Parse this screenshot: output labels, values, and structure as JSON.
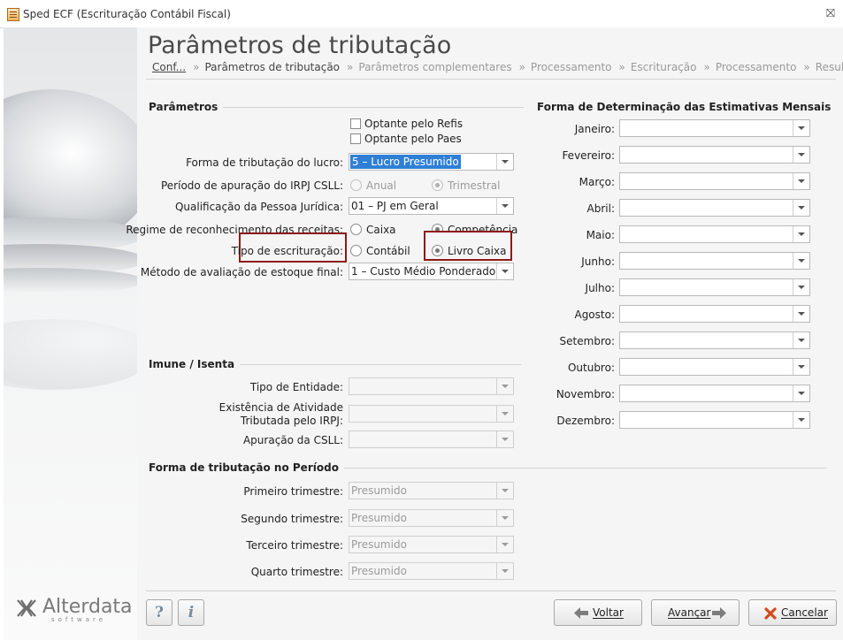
{
  "window": {
    "title": "Sped ECF (Escrituração Contábil Fiscal)"
  },
  "header": {
    "title": "Parâmetros de tributação",
    "breadcrumb": [
      "Conf...",
      "Parâmetros de tributação",
      "Parâmetros complementares",
      "Processamento",
      "Escrituração",
      "Processamento",
      "Resultado"
    ],
    "sep": "»"
  },
  "parametros": {
    "title": "Parâmetros",
    "refis_label": "Optante pelo Refis",
    "paes_label": "Optante pelo Paes",
    "forma_label": "Forma de tributação do lucro:",
    "forma_value": "5 – Lucro Presumido",
    "periodo_label": "Período de apuração do IRPJ CSLL:",
    "periodo_opt1": "Anual",
    "periodo_opt2": "Trimestral",
    "qualif_label": "Qualificação da Pessoa Jurídica:",
    "qualif_value": "01 – PJ em Geral",
    "regime_label": "Regime de reconhecimento das receitas:",
    "regime_opt1": "Caixa",
    "regime_opt2": "Competência",
    "tipo_label": "Tipo de escrituração:",
    "tipo_opt1": "Contábil",
    "tipo_opt2": "Livro Caixa",
    "metodo_label": "Método de avaliação de estoque final:",
    "metodo_value": "1 – Custo Médio Ponderado"
  },
  "imune": {
    "title": "Imune / Isenta",
    "tipo_label": "Tipo de Entidade:",
    "exist_label1": "Existência de Atividade",
    "exist_label2": "Tributada pelo IRPJ:",
    "csll_label": "Apuração da CSLL:"
  },
  "periodo": {
    "title": "Forma de tributação no Período",
    "rows": [
      {
        "label": "Primeiro trimestre:",
        "value": "Presumido"
      },
      {
        "label": "Segundo trimestre:",
        "value": "Presumido"
      },
      {
        "label": "Terceiro trimestre:",
        "value": "Presumido"
      },
      {
        "label": "Quarto trimestre:",
        "value": "Presumido"
      }
    ]
  },
  "estimativas": {
    "title": "Forma de Determinação das Estimativas Mensais",
    "months": [
      "Janeiro:",
      "Fevereiro:",
      "Março:",
      "Abril:",
      "Maio:",
      "Junho:",
      "Julho:",
      "Agosto:",
      "Setembro:",
      "Outubro:",
      "Novembro:",
      "Dezembro:"
    ]
  },
  "footer": {
    "help": "?",
    "info": "i",
    "back": "Voltar",
    "next": "Avançar",
    "cancel": "Cancelar"
  },
  "brand": {
    "name": "Alterdata",
    "sub": "software"
  },
  "colors": {
    "highlight": "#8b1a1a",
    "selection": "#2f7fd6",
    "panel": "#f5f5f5"
  }
}
